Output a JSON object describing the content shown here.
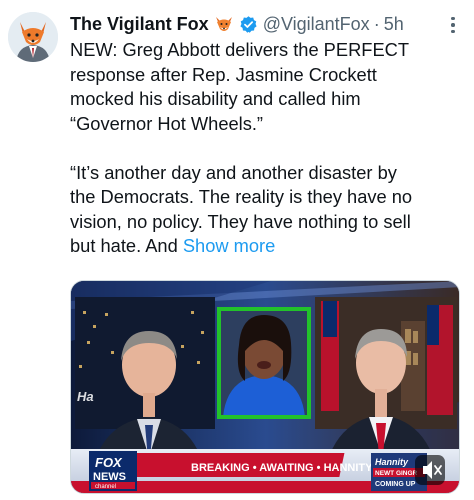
{
  "tweet": {
    "author_name": "The Vigilant Fox",
    "handle": "@VigilantFox",
    "separator": "·",
    "time": "5h",
    "text_lines": [
      "NEW: Greg Abbott delivers the PERFECT",
      "response after Rep. Jasmine Crockett",
      "mocked his disability and called him",
      "“Governor Hot Wheels.”"
    ],
    "quote_lines": [
      "“It’s another day and another disaster by",
      "the Democrats. The reality is they have no",
      "vision, no policy. They have nothing to sell"
    ],
    "last_line_prefix": "but hate. And ",
    "show_more": "Show more"
  },
  "icons": {
    "avatar": "fox-avatar-icon",
    "fox_emoji": "fox-emoji-icon",
    "verified": "verified-badge-icon",
    "more": "more-options-icon",
    "mute": "mute-icon"
  },
  "media": {
    "network_logo_top": "FOX",
    "network_logo_bottom": "NEWS",
    "network_logo_channel": "channel",
    "show_badge": "Hannity",
    "show_badge_sub_1": "NEWT GINGR",
    "show_badge_sub_2": "COMING UP",
    "chyron_text": "BREAKING • AWAITING • HANNITY",
    "colors": {
      "highlight_box": "#22c22b",
      "chyron_red": "#c8102e",
      "studio_blue": "#1f3a7a"
    }
  },
  "colors": {
    "link": "#1d9bf0",
    "verified": "#1d9bf0",
    "secondary_text": "#536471"
  }
}
